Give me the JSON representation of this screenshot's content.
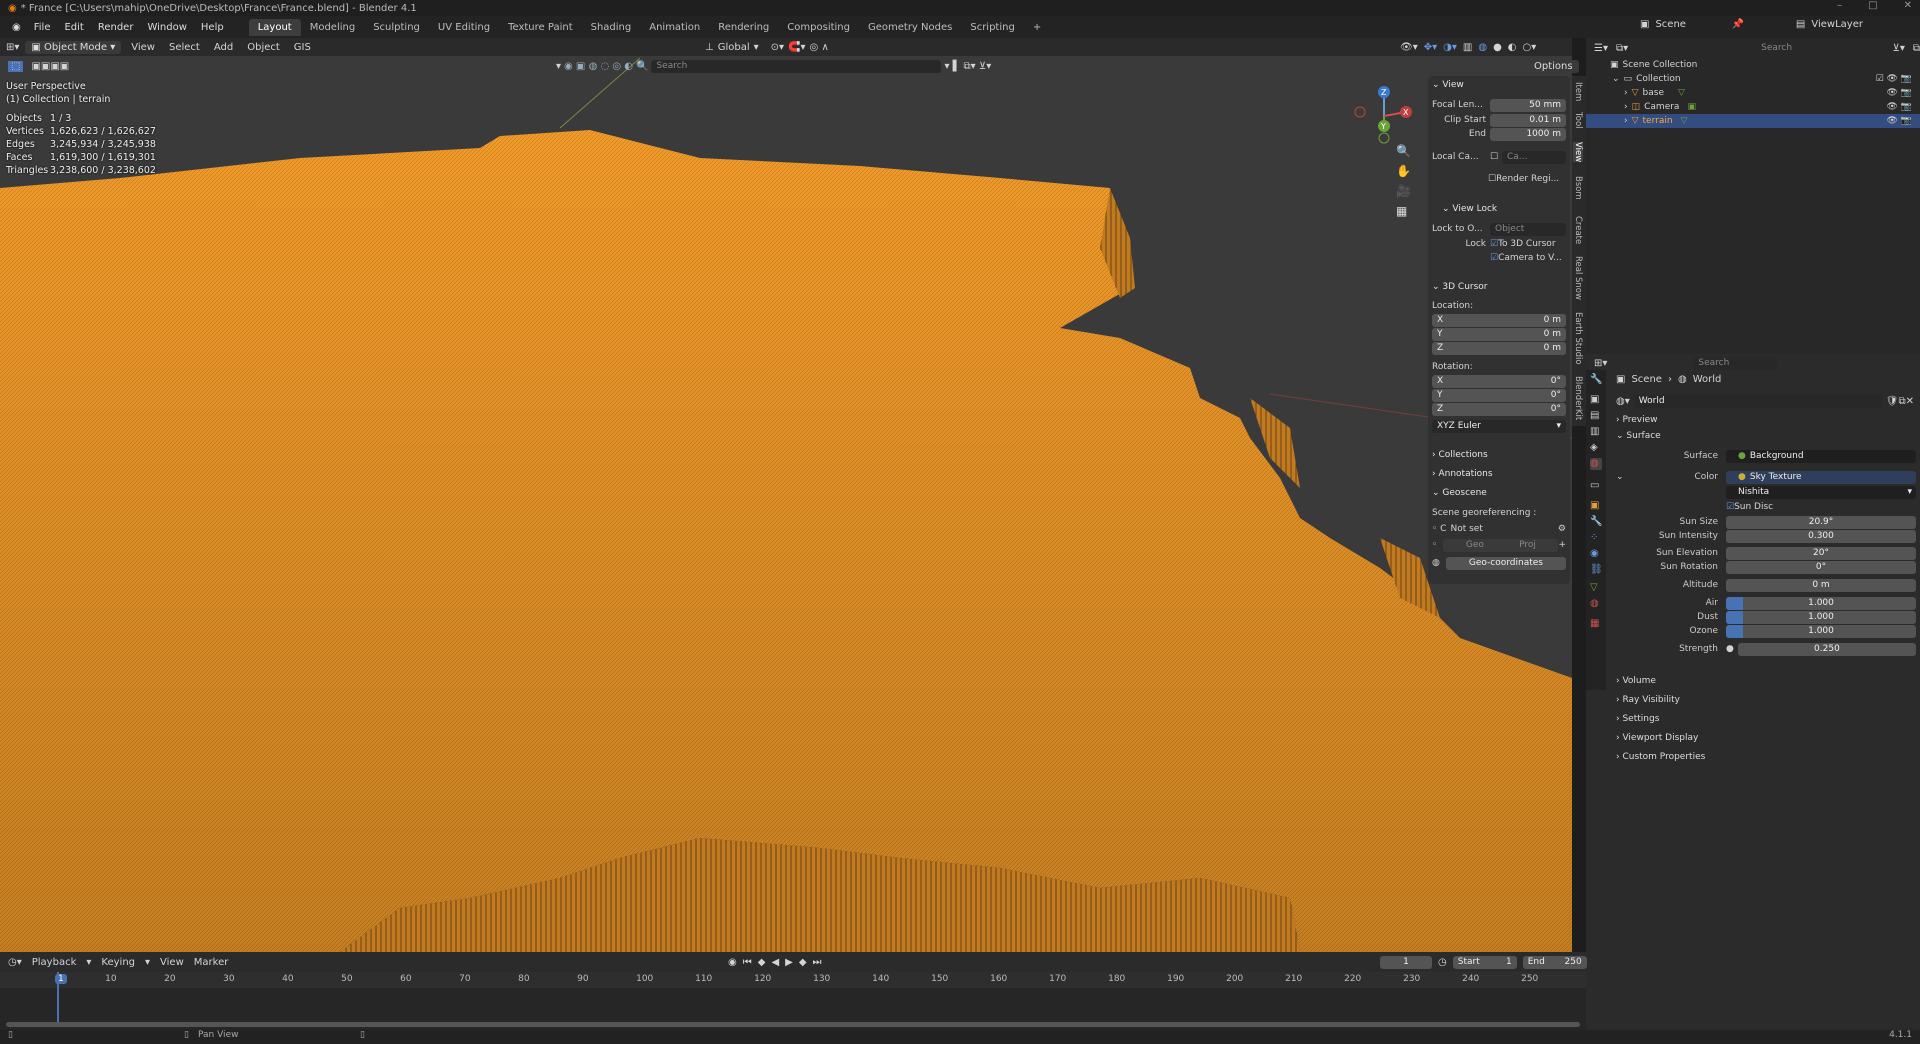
{
  "window": {
    "title": "* France [C:\\Users\\mahip\\OneDrive\\Desktop\\France\\France.blend] - Blender 4.1"
  },
  "menu": [
    "File",
    "Edit",
    "Render",
    "Window",
    "Help"
  ],
  "workspaces": [
    "Layout",
    "Modeling",
    "Sculpting",
    "UV Editing",
    "Texture Paint",
    "Shading",
    "Animation",
    "Rendering",
    "Compositing",
    "Geometry Nodes",
    "Scripting"
  ],
  "active_workspace": "Layout",
  "scene": {
    "label": "Scene",
    "view_layer": "ViewLayer"
  },
  "viewport": {
    "mode": "Object Mode",
    "menus": [
      "View",
      "Select",
      "Add",
      "Object",
      "GIS"
    ],
    "transform": "Global",
    "search_placeholder": "Search",
    "options": "Options",
    "perspective": "User Perspective",
    "collection": "(1) Collection | terrain",
    "stats": [
      {
        "label": "Objects",
        "value": "1 / 3"
      },
      {
        "label": "Vertices",
        "value": "1,626,623 / 1,626,627"
      },
      {
        "label": "Edges",
        "value": "3,245,934 / 3,245,938"
      },
      {
        "label": "Faces",
        "value": "1,619,300 / 1,619,301"
      },
      {
        "label": "Triangles",
        "value": "3,238,600 / 3,238,602"
      }
    ],
    "terrain_color": "#f09a2a",
    "bg_color": "#3a3a3a"
  },
  "npanel": {
    "view": "View",
    "focal_label": "Focal Len...",
    "focal": "50 mm",
    "clip_start_label": "Clip Start",
    "clip_start": "0.01 m",
    "end_label": "End",
    "end": "1000 m",
    "local_cam_label": "Local Ca...",
    "local_cam": "Ca...",
    "render_region": "Render Regi...",
    "view_lock": "View Lock",
    "lock_to_label": "Lock to O...",
    "lock_to": "Object",
    "lock_label": "Lock",
    "to_3d_cursor": "To 3D Cursor",
    "camera_to_view": "Camera to V...",
    "cursor": "3D Cursor",
    "location": "Location:",
    "loc": [
      {
        "axis": "X",
        "v": "0 m"
      },
      {
        "axis": "Y",
        "v": "0 m"
      },
      {
        "axis": "Z",
        "v": "0 m"
      }
    ],
    "rotation": "Rotation:",
    "rot": [
      {
        "axis": "X",
        "v": "0°"
      },
      {
        "axis": "Y",
        "v": "0°"
      },
      {
        "axis": "Z",
        "v": "0°"
      }
    ],
    "rot_mode": "XYZ Euler",
    "collections": "Collections",
    "annotations": "Annotations",
    "geoscene": "Geoscene",
    "georef": "Scene georeferencing :",
    "not_set": "Not set",
    "geo": "Geo",
    "proj": "Proj",
    "geo_coords": "Geo-coordinates",
    "tabs": [
      "Item",
      "Tool",
      "View",
      "Bsom",
      "Create",
      "Real Snow",
      "Earth Studio",
      "BlenderKit"
    ]
  },
  "outliner": {
    "search": "Search",
    "scene_collection": "Scene Collection",
    "collection": "Collection",
    "items": [
      "base",
      "Camera",
      "terrain"
    ]
  },
  "properties": {
    "search": "Search",
    "breadcrumb_scene": "Scene",
    "breadcrumb_world": "World",
    "world_name": "World",
    "preview": "Preview",
    "surface_section": "Surface",
    "surface_label": "Surface",
    "surface": "Background",
    "color_label": "Color",
    "color": "Sky Texture",
    "sky_type": "Nishita",
    "sun_disc": "Sun Disc",
    "rows": [
      {
        "label": "Sun Size",
        "value": "20.9°"
      },
      {
        "label": "Sun Intensity",
        "value": "0.300"
      },
      {
        "label": "Sun Elevation",
        "value": "20°"
      },
      {
        "label": "Sun Rotation",
        "value": "0°"
      },
      {
        "label": "Altitude",
        "value": "0 m"
      },
      {
        "label": "Air",
        "value": "1.000"
      },
      {
        "label": "Dust",
        "value": "1.000"
      },
      {
        "label": "Ozone",
        "value": "1.000"
      },
      {
        "label": "Strength",
        "value": "0.250"
      }
    ],
    "sections": [
      "Volume",
      "Ray Visibility",
      "Settings",
      "Viewport Display",
      "Custom Properties"
    ]
  },
  "timeline": {
    "menus": [
      "Playback",
      "Keying",
      "View",
      "Marker"
    ],
    "current_frame": "1",
    "start_label": "Start",
    "start": "1",
    "end_label": "End",
    "end": "250",
    "ticks": [
      "1",
      "10",
      "20",
      "30",
      "40",
      "50",
      "60",
      "70",
      "80",
      "90",
      "100",
      "110",
      "120",
      "130",
      "140",
      "150",
      "160",
      "170",
      "180",
      "190",
      "200",
      "210",
      "220",
      "230",
      "240",
      "250"
    ]
  },
  "status": {
    "pan_view": "Pan View",
    "version": "4.1.1"
  }
}
